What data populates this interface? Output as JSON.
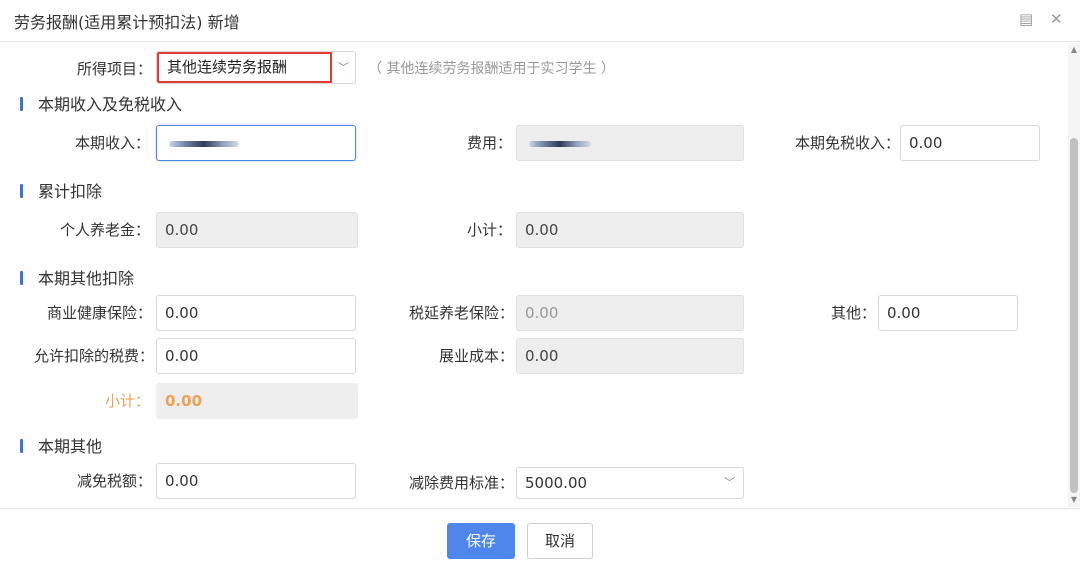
{
  "window": {
    "title": "劳务报酬(适用累计预扣法) 新增",
    "maximize_glyph": "▤",
    "close_glyph": "✕"
  },
  "income_item": {
    "label": "所得项目：",
    "selected": "其他连续劳务报酬",
    "hint": "（ 其他连续劳务报酬适用于实习学生 ）",
    "highlight_color": "#e53935"
  },
  "sections": {
    "current_income": {
      "title": "本期收入及免税收入",
      "income_label": "本期收入：",
      "expense_label": "费用：",
      "tax_free_label": "本期免税收入：",
      "tax_free_value": "0.00"
    },
    "cumulative_deduction": {
      "title": "累计扣除",
      "pension_label": "个人养老金：",
      "pension_value": "0.00",
      "subtotal_label": "小计：",
      "subtotal_value": "0.00"
    },
    "other_deductions": {
      "title": "本期其他扣除",
      "health_label": "商业健康保险：",
      "health_value": "0.00",
      "deferred_pension_label": "税延养老保险：",
      "deferred_pension_value": "0.00",
      "other_label": "其他：",
      "other_value": "0.00",
      "allowed_tax_label": "允许扣除的税费：",
      "allowed_tax_value": "0.00",
      "exhibition_cost_label": "展业成本：",
      "exhibition_cost_value": "0.00",
      "subtotal_label": "小计：",
      "subtotal_value": "0.00",
      "subtotal_color": "#f0a050"
    },
    "current_other": {
      "title": "本期其他",
      "tax_relief_label": "减免税额：",
      "tax_relief_value": "0.00",
      "deduction_standard_label": "减除费用标准：",
      "deduction_standard_value": "5000.00"
    }
  },
  "footer": {
    "save_label": "保存",
    "cancel_label": "取消"
  },
  "colors": {
    "accent": "#4f86ec",
    "section_bar": "#3b73d6"
  }
}
